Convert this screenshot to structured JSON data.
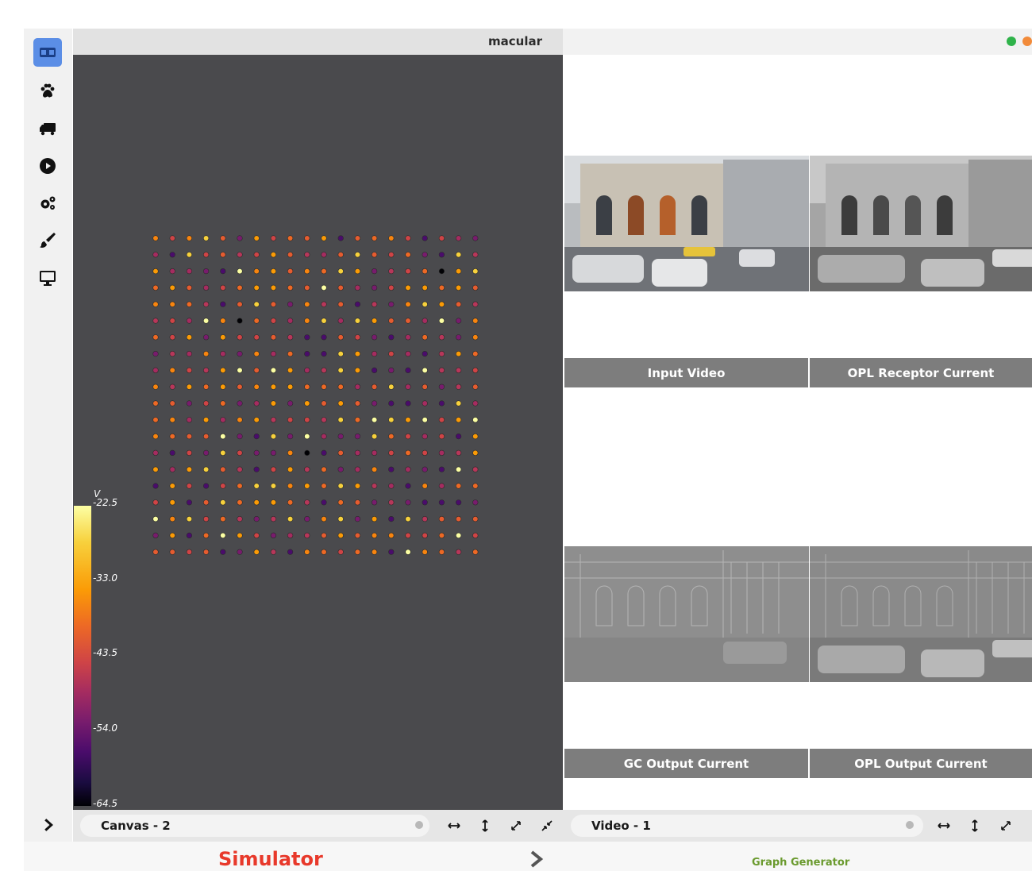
{
  "window": {
    "title": "macular",
    "dot_colors": [
      "#2fb34a",
      "#f28b3a"
    ]
  },
  "sidebar": {
    "icons": [
      "film-icon",
      "paw-icon",
      "truck-icon",
      "play-circle-icon",
      "gears-icon",
      "paintbrush-icon",
      "monitor-icon"
    ],
    "expand_icon": "chevron-right-icon"
  },
  "canvas": {
    "colorbar": {
      "unit": "V",
      "ticks": [
        "-22.5",
        "-33.0",
        "-43.5",
        "-54.0",
        "-64.5"
      ]
    },
    "grid": {
      "rows": 20,
      "cols": 20
    }
  },
  "videos": [
    {
      "label": "Input Video"
    },
    {
      "label": "OPL Receptor Current"
    },
    {
      "label": "GC Output Current"
    },
    {
      "label": "OPL Output Current"
    }
  ],
  "toolbar_left": {
    "tab_label": "Canvas - 2"
  },
  "toolbar_right": {
    "tab_label": "Video - 1"
  },
  "footer": {
    "simulator_label": "Simulator",
    "graph_label": "Graph Generator"
  }
}
